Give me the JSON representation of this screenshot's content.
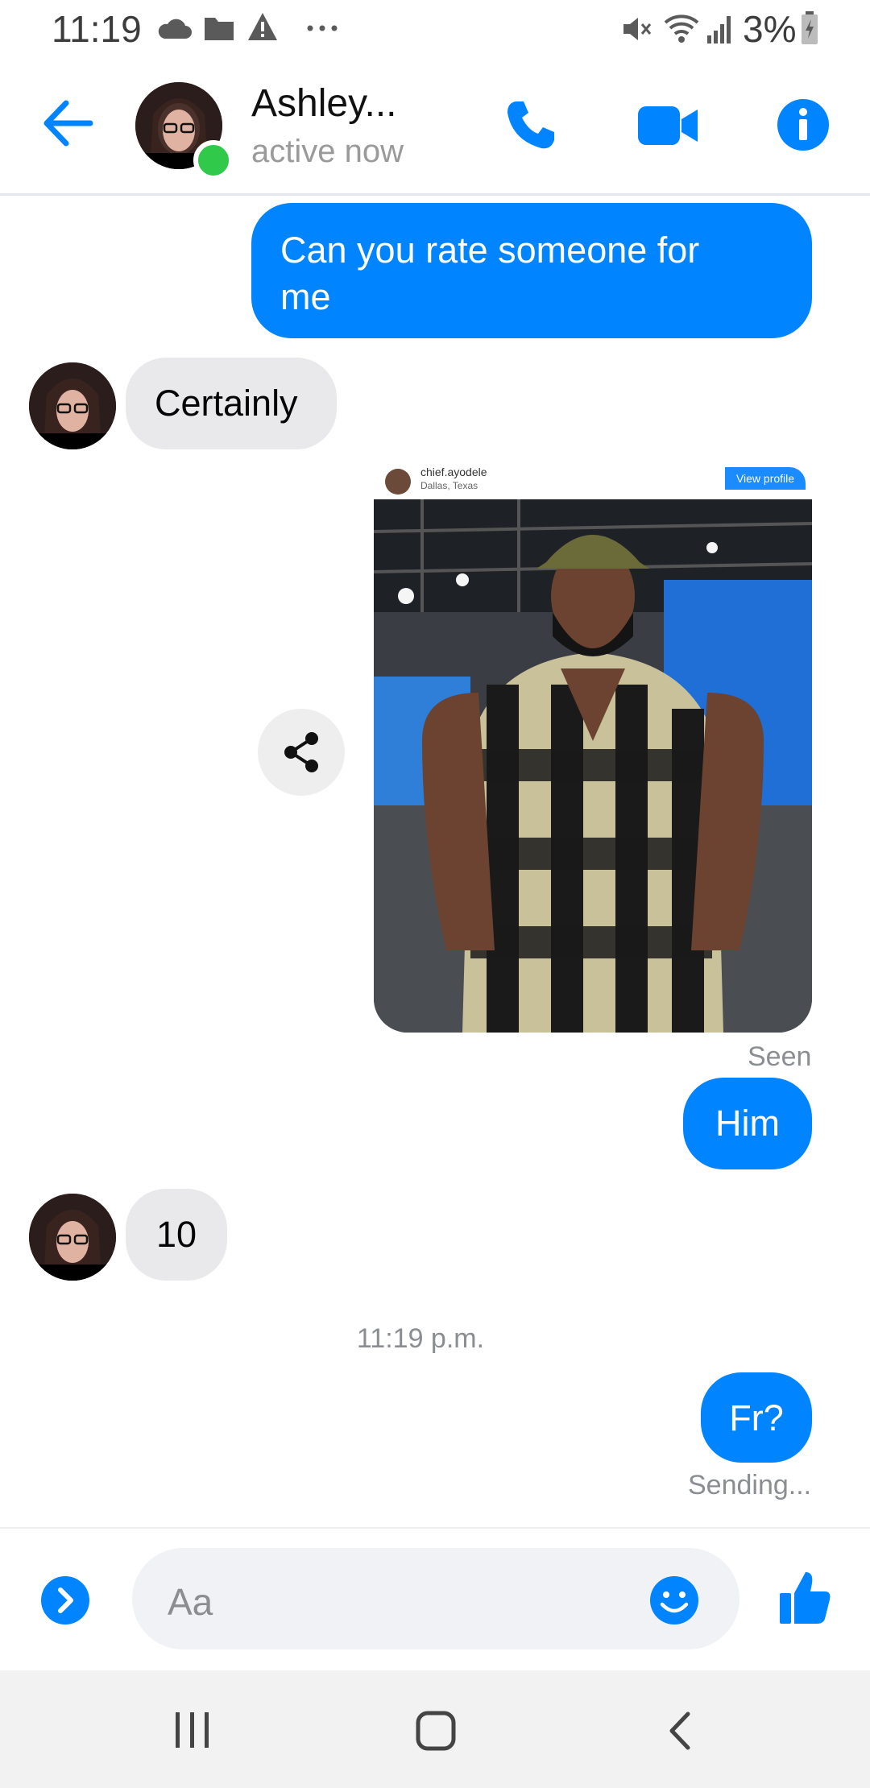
{
  "status_bar": {
    "time": "11:19",
    "battery_percent": "3%",
    "icons": [
      "cloud-icon",
      "folder-icon",
      "warning-icon",
      "more-dots-icon",
      "mute-icon",
      "wifi-icon",
      "signal-icon",
      "battery-charging-icon"
    ]
  },
  "header": {
    "contact_name": "Ashley...",
    "status": "active now",
    "icons": [
      "back-arrow-icon",
      "phone-icon",
      "video-camera-icon",
      "info-icon"
    ]
  },
  "messages": {
    "m1": "Can you rate someone for",
    "m1b": "me",
    "m2": "Certainly",
    "shared_post": {
      "username": "chief.ayodele",
      "location": "Dallas, Texas",
      "view_profile_label": "View profile"
    },
    "seen_label": "Seen",
    "m3": "Him",
    "m4": "10",
    "timestamp": "11:19 p.m.",
    "m5": "Fr?",
    "sending_label": "Sending..."
  },
  "composer": {
    "placeholder": "Aa"
  },
  "colors": {
    "accent": "#0084ff",
    "incoming_bubble": "#e9e9eb",
    "online": "#31c94a"
  }
}
